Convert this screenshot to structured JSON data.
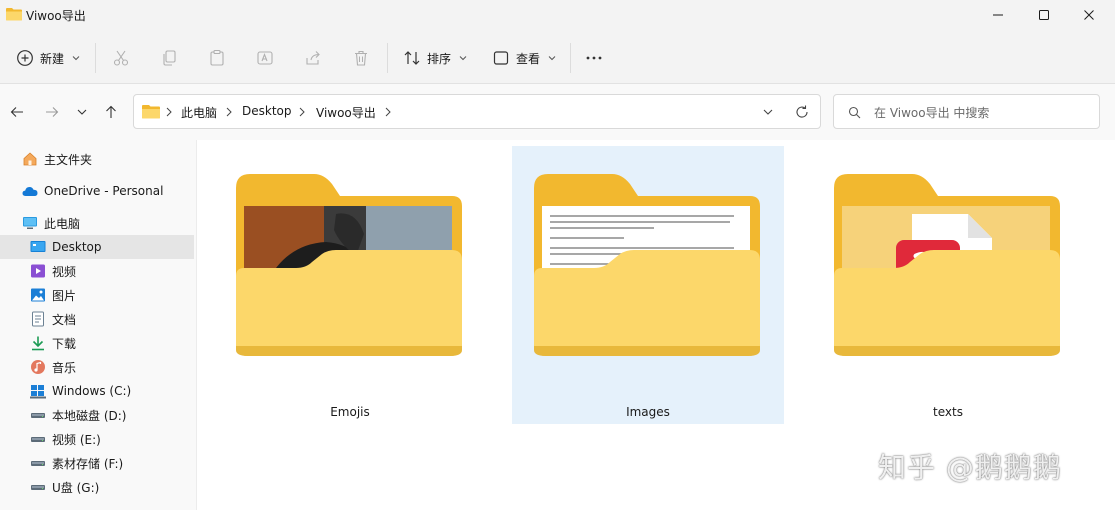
{
  "window": {
    "title": "Viwoo导出"
  },
  "toolbar": {
    "new_label": "新建",
    "sort_label": "排序",
    "view_label": "查看",
    "more_icon": "more-icon"
  },
  "address": {
    "crumbs": [
      "此电脑",
      "Desktop",
      "Viwoo导出"
    ]
  },
  "search": {
    "placeholder": "在 Viwoo导出 中搜索"
  },
  "sidebar": {
    "items": [
      {
        "label": "主文件夹",
        "icon": "home-icon"
      },
      {
        "label": "OneDrive - Personal",
        "icon": "cloud-icon"
      },
      {
        "label": "此电脑",
        "icon": "computer-icon"
      },
      {
        "label": "Desktop",
        "icon": "desktop-icon",
        "selected": true
      },
      {
        "label": "视频",
        "icon": "video-icon"
      },
      {
        "label": "图片",
        "icon": "picture-icon"
      },
      {
        "label": "文档",
        "icon": "document-icon"
      },
      {
        "label": "下载",
        "icon": "download-icon"
      },
      {
        "label": "音乐",
        "icon": "music-icon"
      },
      {
        "label": "Windows (C:)",
        "icon": "drive-icon"
      },
      {
        "label": "本地磁盘 (D:)",
        "icon": "drive-icon"
      },
      {
        "label": "视频 (E:)",
        "icon": "drive-icon"
      },
      {
        "label": "素材存储 (F:)",
        "icon": "drive-icon"
      },
      {
        "label": "U盘 (G:)",
        "icon": "drive-icon"
      }
    ]
  },
  "files": [
    {
      "name": "Emojis",
      "icon": "folder-photo-icon"
    },
    {
      "name": "Images",
      "icon": "folder-document-icon",
      "selected": true
    },
    {
      "name": "texts",
      "icon": "folder-app-icon"
    }
  ],
  "watermark": "知乎 @鹅鹅鹅",
  "colors": {
    "folder_front": "#fcd76a",
    "folder_back": "#f2b82f",
    "selection": "#e5f1fb",
    "accent": "#0067c0"
  }
}
